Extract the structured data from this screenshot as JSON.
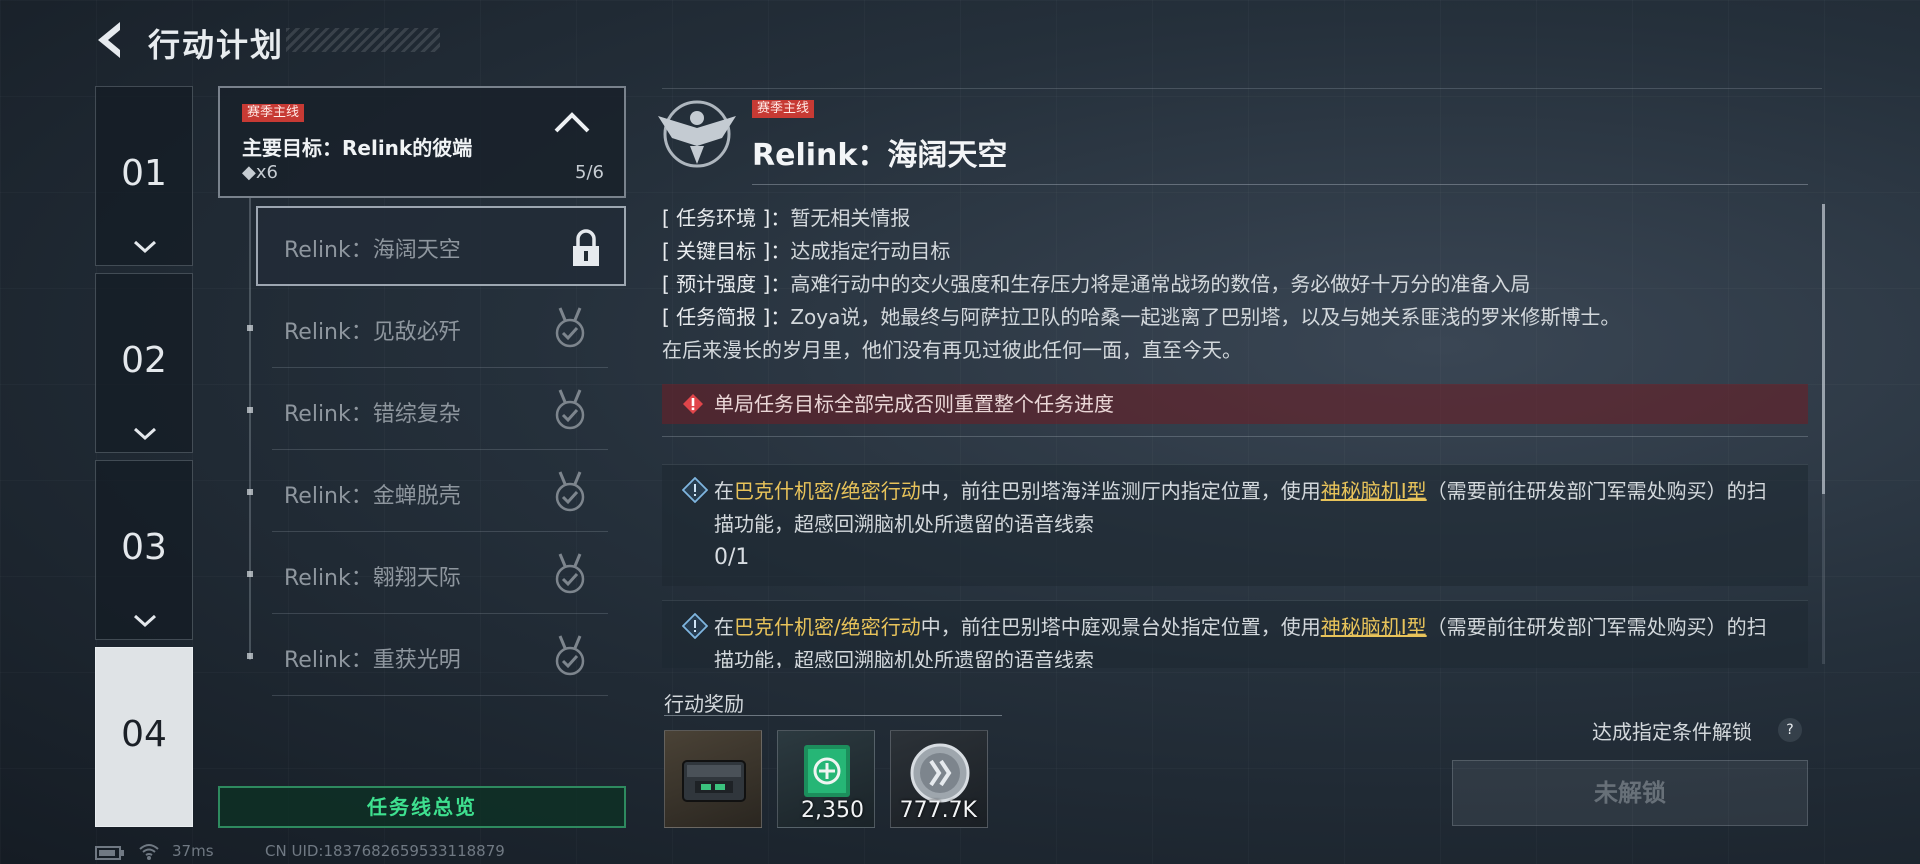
{
  "header": {
    "title": "行动计划"
  },
  "chapters": [
    {
      "label": "01"
    },
    {
      "label": "02"
    },
    {
      "label": "03"
    },
    {
      "label": "04",
      "active": true
    }
  ],
  "main_goal": {
    "tag": "赛季主线",
    "title": "主要目标：Relink的彼端",
    "count": "◆x6",
    "progress": "5/6"
  },
  "quests": [
    {
      "label": "Relink：海阔天空",
      "status": "locked",
      "icon": "lock-icon"
    },
    {
      "label": "Relink：见敌必歼",
      "status": "completed",
      "icon": "medal-check-icon"
    },
    {
      "label": "Relink：错综复杂",
      "status": "completed",
      "icon": "medal-check-icon"
    },
    {
      "label": "Relink：金蝉脱壳",
      "status": "completed",
      "icon": "medal-check-icon"
    },
    {
      "label": "Relink：翱翔天际",
      "status": "completed",
      "icon": "medal-check-icon"
    },
    {
      "label": "Relink：重获光明",
      "status": "completed",
      "icon": "medal-check-icon"
    }
  ],
  "overview_button": "任务线总览",
  "status_bar": {
    "ping": "37ms",
    "uid": "CN UID:1837682659533118879"
  },
  "detail": {
    "tag": "赛季主线",
    "title": "Relink：海阔天空",
    "info": [
      {
        "key": "[ 任务环境 ]：",
        "value": "暂无相关情报"
      },
      {
        "key": "[ 关键目标 ]：",
        "value": "达成指定行动目标"
      },
      {
        "key": "[ 预计强度 ]：",
        "value": "高难行动中的交火强度和生存压力将是通常战场的数倍，务必做好十万分的准备入局"
      },
      {
        "key": "[ 任务简报 ]：",
        "value": "Zoya说，她最终与阿萨拉卫队的哈桑一起逃离了巴别塔，以及与她关系匪浅的罗米修斯博士。"
      }
    ],
    "briefing_cont": "在后来漫长的岁月里，他们没有再见过彼此任何一面，直至今天。",
    "warning": "单局任务目标全部完成否则重置整个任务进度",
    "objectives": [
      {
        "pre": "在",
        "mode": "巴克什机密/绝密行动",
        "mid": "中，前往巴别塔海洋监测厅内指定位置，使用",
        "item": "神秘脑机Ⅰ型",
        "post": "（需要前往研发部门军需处购买）的扫描功能，超感回溯脑机处所遗留的语音线索",
        "progress": "0/1"
      },
      {
        "pre": "在",
        "mode": "巴克什机密/绝密行动",
        "mid": "中，前往巴别塔中庭观景台处指定位置，使用",
        "item": "神秘脑机Ⅰ型",
        "post": "（需要前往研发部门军需处购买）的扫描功能，超感回溯脑机处所遗留的语音线索"
      }
    ]
  },
  "rewards": {
    "label": "行动奖励",
    "items": [
      {
        "icon": "supply-case-icon",
        "qty": ""
      },
      {
        "icon": "medkit-card-icon",
        "qty": "2,350"
      },
      {
        "icon": "coin-icon",
        "qty": "777.7K"
      }
    ]
  },
  "unlock": {
    "hint": "达成指定条件解锁",
    "help": "?",
    "button": "未解锁"
  }
}
